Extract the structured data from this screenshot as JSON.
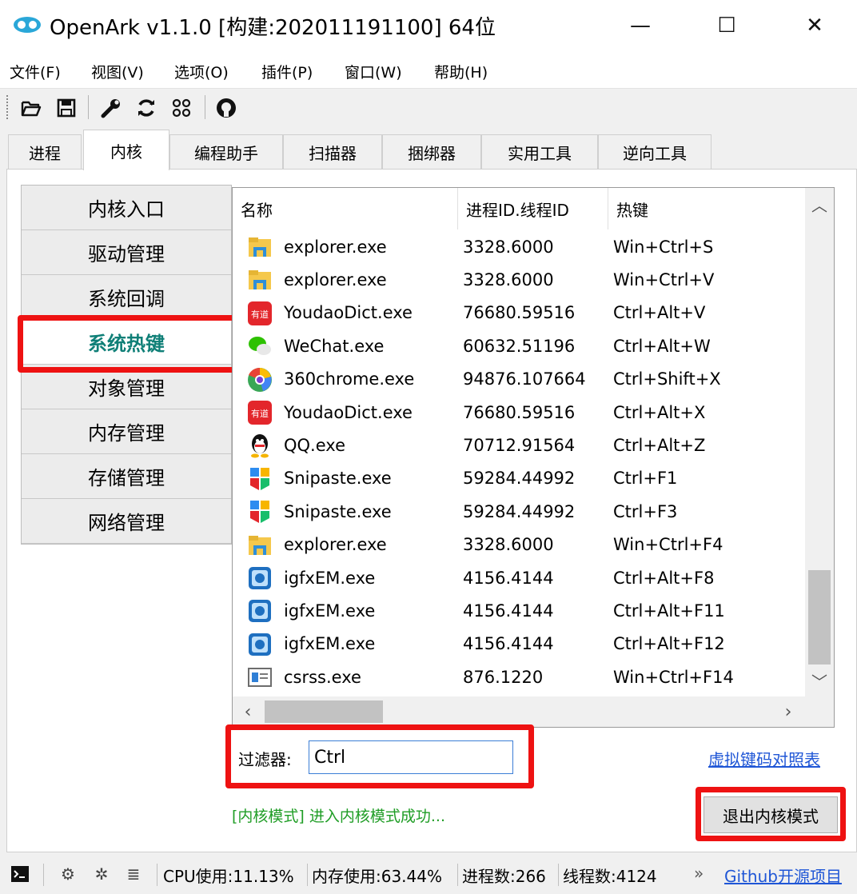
{
  "window": {
    "title": "OpenArk v1.1.0  [构建:202011191100]  64位",
    "minimize_glyph": "—",
    "maximize_glyph": "☐",
    "close_glyph": "✕"
  },
  "menu": [
    {
      "label": "文件(F)"
    },
    {
      "label": "视图(V)"
    },
    {
      "label": "选项(O)"
    },
    {
      "label": "插件(P)"
    },
    {
      "label": "窗口(W)"
    },
    {
      "label": "帮助(H)"
    }
  ],
  "toolbar": {
    "icons": [
      "open-folder-icon",
      "save-icon",
      "wrench-icon",
      "refresh-icon",
      "apps-icon",
      "github-icon"
    ]
  },
  "tabs": [
    {
      "label": "进程"
    },
    {
      "label": "内核",
      "active": true
    },
    {
      "label": "编程助手"
    },
    {
      "label": "扫描器"
    },
    {
      "label": "捆绑器"
    },
    {
      "label": "实用工具"
    },
    {
      "label": "逆向工具"
    }
  ],
  "side_nav": [
    {
      "label": "内核入口"
    },
    {
      "label": "驱动管理"
    },
    {
      "label": "系统回调"
    },
    {
      "label": "系统热键",
      "selected": true
    },
    {
      "label": "对象管理"
    },
    {
      "label": "内存管理"
    },
    {
      "label": "存储管理"
    },
    {
      "label": "网络管理"
    }
  ],
  "hotkey_table": {
    "columns": [
      "名称",
      "进程ID.线程ID",
      "热键"
    ],
    "rows": [
      {
        "name": "explorer.exe",
        "pid_tid": "3328.6000",
        "hotkey": "Win+Ctrl+S",
        "icon": "folder-icon"
      },
      {
        "name": "explorer.exe",
        "pid_tid": "3328.6000",
        "hotkey": "Win+Ctrl+V",
        "icon": "folder-icon"
      },
      {
        "name": "YoudaoDict.exe",
        "pid_tid": "76680.59516",
        "hotkey": "Ctrl+Alt+V",
        "icon": "youdao-icon"
      },
      {
        "name": "WeChat.exe",
        "pid_tid": "60632.51196",
        "hotkey": "Ctrl+Alt+W",
        "icon": "wechat-icon"
      },
      {
        "name": "360chrome.exe",
        "pid_tid": "94876.107664",
        "hotkey": "Ctrl+Shift+X",
        "icon": "360chrome-icon"
      },
      {
        "name": "YoudaoDict.exe",
        "pid_tid": "76680.59516",
        "hotkey": "Ctrl+Alt+X",
        "icon": "youdao-icon"
      },
      {
        "name": "QQ.exe",
        "pid_tid": "70712.91564",
        "hotkey": "Ctrl+Alt+Z",
        "icon": "qq-penguin-icon"
      },
      {
        "name": "Snipaste.exe",
        "pid_tid": "59284.44992",
        "hotkey": "Ctrl+F1",
        "icon": "snipaste-icon"
      },
      {
        "name": "Snipaste.exe",
        "pid_tid": "59284.44992",
        "hotkey": "Ctrl+F3",
        "icon": "snipaste-icon"
      },
      {
        "name": "explorer.exe",
        "pid_tid": "3328.6000",
        "hotkey": "Win+Ctrl+F4",
        "icon": "folder-icon"
      },
      {
        "name": "igfxEM.exe",
        "pid_tid": "4156.4144",
        "hotkey": "Ctrl+Alt+F8",
        "icon": "intel-graphics-icon"
      },
      {
        "name": "igfxEM.exe",
        "pid_tid": "4156.4144",
        "hotkey": "Ctrl+Alt+F11",
        "icon": "intel-graphics-icon"
      },
      {
        "name": "igfxEM.exe",
        "pid_tid": "4156.4144",
        "hotkey": "Ctrl+Alt+F12",
        "icon": "intel-graphics-icon"
      },
      {
        "name": "csrss.exe",
        "pid_tid": "876.1220",
        "hotkey": "Win+Ctrl+F14",
        "icon": "window-app-icon"
      }
    ]
  },
  "filter": {
    "label": "过滤器:",
    "value": "Ctrl"
  },
  "keymap_link": "虚拟键码对照表",
  "status_message": "[内核模式] 进入内核模式成功...",
  "exit_kernel_button": "退出内核模式",
  "statusbar": {
    "cpu": "CPU使用:11.13%",
    "memory": "内存使用:63.44%",
    "process_count": "进程数:266",
    "thread_count": "线程数:4124",
    "overflow": "»",
    "github_link": "Github开源项目"
  },
  "colors": {
    "highlight_red": "#ee1212",
    "selected_nav": "#0f7f77",
    "status_green": "#1f9d25",
    "link_blue": "#1f56d6"
  }
}
